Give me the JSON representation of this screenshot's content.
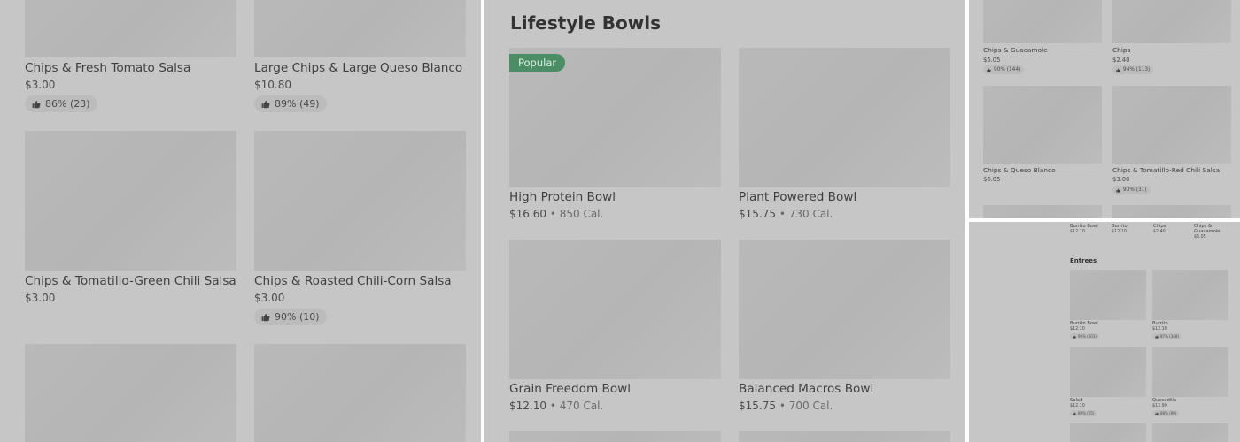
{
  "left_panel": {
    "cards": [
      {
        "title": "Chips & Fresh Tomato Salsa",
        "price": "$3.00",
        "rating": "86% (23)"
      },
      {
        "title": "Large Chips & Large Queso Blanco",
        "price": "$10.80",
        "rating": "89% (49)"
      },
      {
        "title": "Chips & Tomatillo-Green Chili Salsa",
        "price": "$3.00"
      },
      {
        "title": "Chips & Roasted Chili-Corn Salsa",
        "price": "$3.00",
        "rating": "90% (10)"
      }
    ]
  },
  "center_panel": {
    "section_title": "Lifestyle Bowls",
    "badge": "Popular",
    "cards": [
      {
        "title": "High Protein Bowl",
        "price": "$16.60",
        "calories": "850 Cal."
      },
      {
        "title": "Plant Powered Bowl",
        "price": "$15.75",
        "calories": "730 Cal."
      },
      {
        "title": "Grain Freedom Bowl",
        "price": "$12.10",
        "calories": "470 Cal."
      },
      {
        "title": "Balanced Macros Bowl",
        "price": "$15.75",
        "calories": "700 Cal."
      }
    ],
    "separator": "•"
  },
  "top_right_panel": {
    "cards": [
      {
        "title": "Chips & Guacamole",
        "price": "$6.05",
        "rating": "90% (144)"
      },
      {
        "title": "Chips",
        "price": "$2.40",
        "rating": "94% (113)"
      },
      {
        "title": "Chips & Queso Blanco",
        "price": "$6.05"
      },
      {
        "title": "Chips & Tomatillo-Red Chili Salsa",
        "price": "$3.00",
        "rating": "93% (31)"
      }
    ]
  },
  "bottom_right_panel": {
    "top_items": [
      {
        "title": "Burrito Bowl",
        "price": "$12.10"
      },
      {
        "title": "Burrito",
        "price": "$12.10"
      },
      {
        "title": "Chips",
        "price": "$2.40"
      },
      {
        "title": "Chips & Guacamole",
        "price": "$6.05"
      }
    ],
    "section_title": "Entrees",
    "cards": [
      {
        "title": "Burrito Bowl",
        "price": "$12.10",
        "rating": "90% (603)"
      },
      {
        "title": "Burrito",
        "price": "$12.10",
        "rating": "87% (348)"
      },
      {
        "title": "Salad",
        "price": "$12.10",
        "rating": "89% (65)"
      },
      {
        "title": "Quesadilla",
        "price": "$12.90",
        "rating": "88% (99)"
      }
    ]
  },
  "colors": {
    "panel_bg": "#c6c6c6",
    "image_placeholder": "#b8b8b8",
    "badge": "#4b8d64",
    "text": "#3f3f3f"
  }
}
